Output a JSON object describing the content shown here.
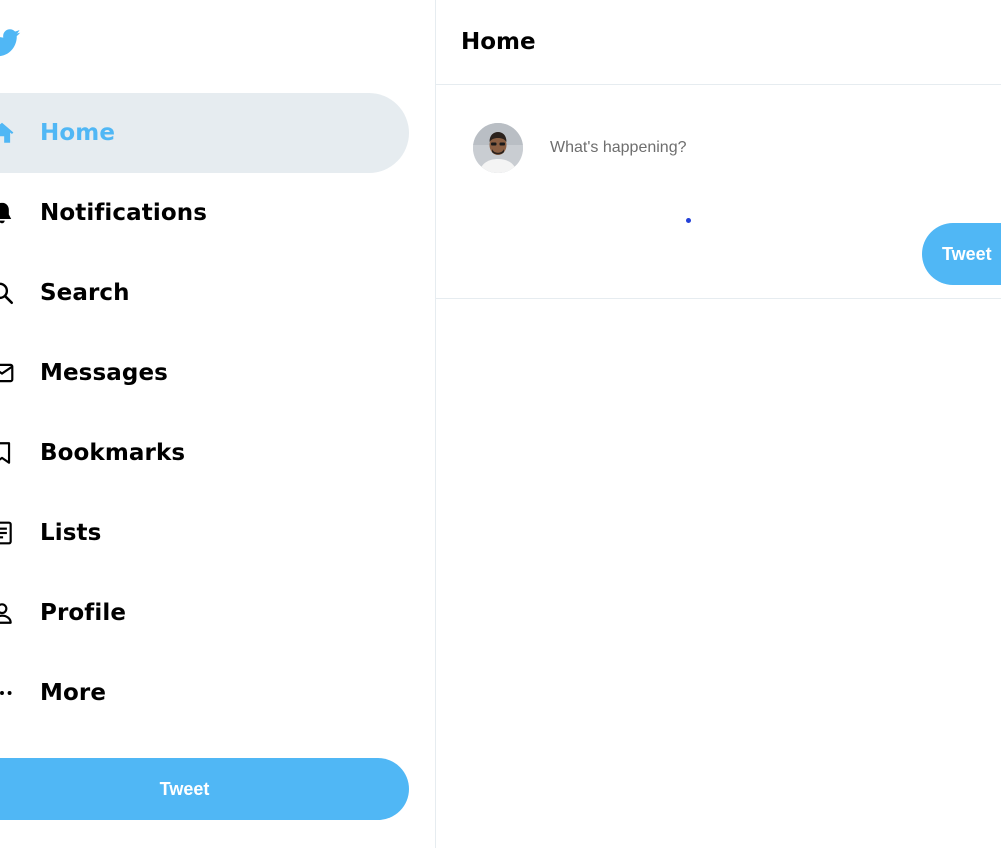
{
  "sidebar": {
    "logo_icon": "twitter-bird-icon",
    "items": [
      {
        "label": "Home",
        "icon": "home-icon",
        "active": true
      },
      {
        "label": "Notifications",
        "icon": "bell-icon",
        "active": false
      },
      {
        "label": "Search",
        "icon": "search-icon",
        "active": false
      },
      {
        "label": "Messages",
        "icon": "mail-icon",
        "active": false
      },
      {
        "label": "Bookmarks",
        "icon": "bookmark-icon",
        "active": false
      },
      {
        "label": "Lists",
        "icon": "list-icon",
        "active": false
      },
      {
        "label": "Profile",
        "icon": "profile-icon",
        "active": false
      },
      {
        "label": "More",
        "icon": "more-icon",
        "active": false
      }
    ],
    "tweet_button": "Tweet"
  },
  "main": {
    "title": "Home",
    "composer": {
      "placeholder": "What's happening?",
      "value": "",
      "tweet_button": "Tweet"
    }
  },
  "colors": {
    "accent": "#50b7f5",
    "active_bg": "#e6ecf0",
    "divider": "#e6ecf0"
  }
}
